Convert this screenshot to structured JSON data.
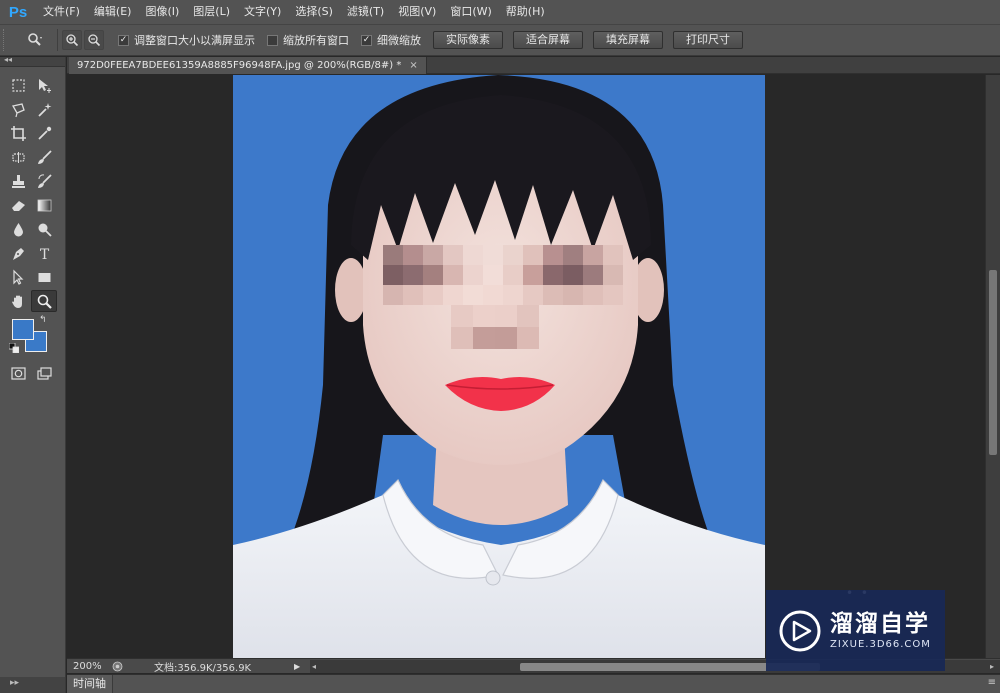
{
  "app": {
    "logo": "Ps"
  },
  "menu": [
    "文件(F)",
    "编辑(E)",
    "图像(I)",
    "图层(L)",
    "文字(Y)",
    "选择(S)",
    "滤镜(T)",
    "视图(V)",
    "窗口(W)",
    "帮助(H)"
  ],
  "options": {
    "tool_icon": "zoom-tool-icon",
    "zoom_in_icon": "zoom-in-icon",
    "zoom_out_icon": "zoom-out-icon",
    "check_resize_windows": {
      "label": "调整窗口大小以满屏显示",
      "checked": true
    },
    "check_zoom_all_windows": {
      "label": "缩放所有窗口",
      "checked": false
    },
    "check_scrubby_zoom": {
      "label": "细微缩放",
      "checked": true
    },
    "btn_actual_pixels": "实际像素",
    "btn_fit_screen": "适合屏幕",
    "btn_fill_screen": "填充屏幕",
    "btn_print_size": "打印尺寸"
  },
  "document": {
    "tab_title": "972D0FEEA7BDEE61359A8885F96948FA.jpg @ 200%(RGB/8#) *",
    "close": "×"
  },
  "colors": {
    "foreground": "#3979c7",
    "background": "#3a7ac8",
    "photo_background": "#3c78c9"
  },
  "status": {
    "zoom": "200%",
    "doc_size": "文档:356.9K/356.9K",
    "arrow": "▶"
  },
  "timeline": {
    "tab": "时间轴"
  },
  "watermark": {
    "chinese": "溜溜自学",
    "english": "ZIXUE.3D66.COM"
  }
}
